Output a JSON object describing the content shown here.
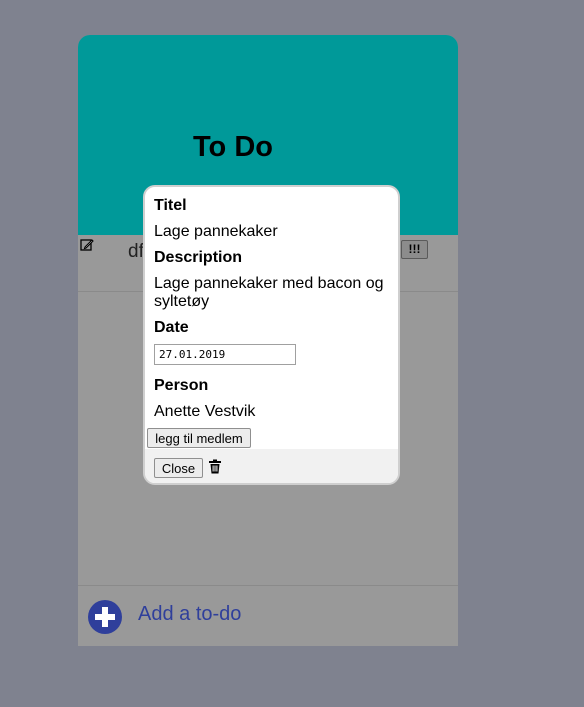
{
  "card": {
    "title": "To Do",
    "todo_item": {
      "text": "df",
      "priority_label": "!!!",
      "edit_icon": "edit-icon"
    },
    "add_label": "Add a to-do",
    "add_icon": "plus-circle-icon",
    "colors": {
      "header": "#009999",
      "body": "#999999",
      "add_accent": "#2f3f9b"
    }
  },
  "modal": {
    "title_label": "Titel",
    "title_value": "Lage pannekaker",
    "description_label": "Description",
    "description_value": "Lage pannekaker med bacon og syltetøy",
    "date_label": "Date",
    "date_value": "27.01.2019",
    "person_label": "Person",
    "person_value": "Anette Vestvik",
    "add_member_label": "legg til medlem",
    "close_label": "Close",
    "delete_icon": "trash-icon"
  }
}
